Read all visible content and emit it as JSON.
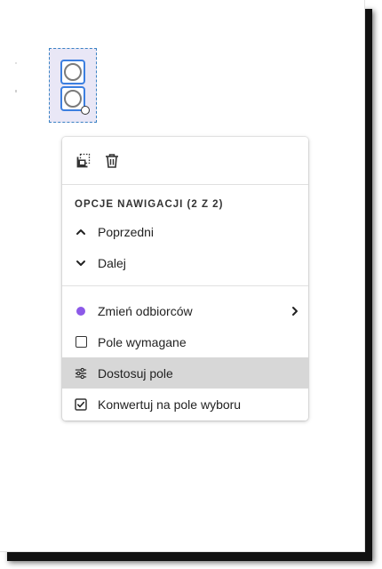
{
  "menu": {
    "toolbar": {
      "duplicate_icon": "duplicate-icon",
      "delete_icon": "trash-icon"
    },
    "navigation_header": "OPCJE NAWIGACJI (2 Z 2)",
    "prev_label": "Poprzedni",
    "next_label": "Dalej",
    "change_recipients_label": "Zmień odbiorców",
    "recipient_color": "#8c59e8",
    "required_label": "Pole wymagane",
    "required_checked": false,
    "customize_label": "Dostosuj pole",
    "convert_label": "Konwertuj na pole wyboru"
  },
  "form_field": {
    "type": "radio-group",
    "buttons": 2,
    "selection_color": "#3c7fe0"
  }
}
